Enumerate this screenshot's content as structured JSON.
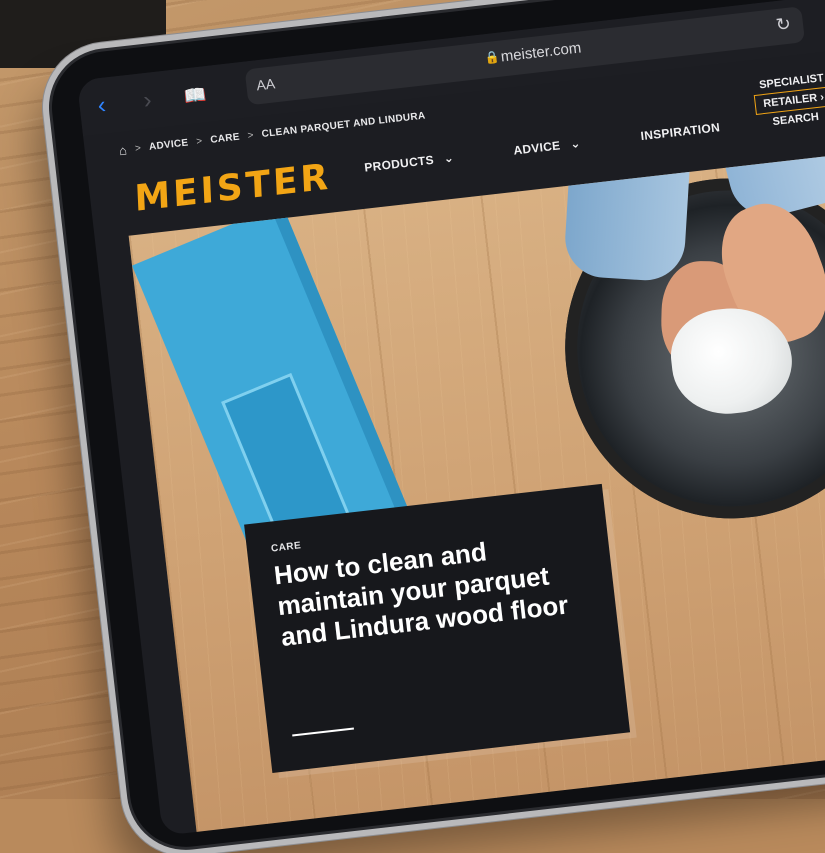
{
  "browser": {
    "text_size_label": "AA",
    "url": "meister.com",
    "icons": [
      "back-icon",
      "forward-icon",
      "bookmarks-icon",
      "lock-icon",
      "reload-icon"
    ]
  },
  "breadcrumb": {
    "items": [
      "ADVICE",
      "CARE",
      "CLEAN PARQUET AND LINDURA"
    ]
  },
  "site": {
    "logo": "MEISTER",
    "nav": {
      "products": "PRODUCTS",
      "advice": "ADVICE",
      "inspiration": "INSPIRATION"
    },
    "retailer": {
      "line1": "SPECIALIST",
      "line2": "RETAILER",
      "line3": "SEARCH"
    }
  },
  "hero": {
    "tag": "CARE",
    "title": "How to clean and maintain your parquet and Lindura wood floor"
  },
  "colors": {
    "accent": "#f2a515",
    "header_bg": "#1c1d22",
    "link_blue": "#2f84ff"
  }
}
